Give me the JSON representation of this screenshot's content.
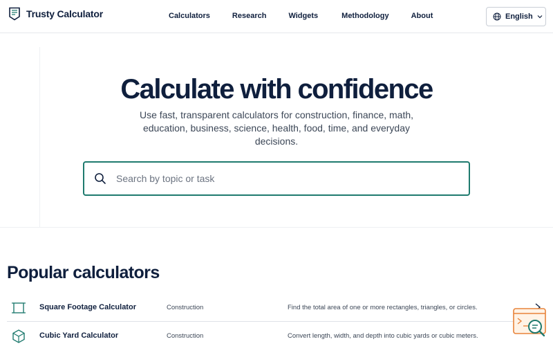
{
  "header": {
    "brand_name": "Trusty Calculator",
    "nav": [
      {
        "label": "Calculators"
      },
      {
        "label": "Research"
      },
      {
        "label": "Widgets"
      },
      {
        "label": "Methodology"
      },
      {
        "label": "About"
      }
    ],
    "language": {
      "label": "English",
      "icon": "globe-icon"
    }
  },
  "hero": {
    "title": "Calculate with confidence",
    "subtitle": "Use fast, transparent calculators for construction, finance, math, education, business, science, health, food, time, and everyday decisions.",
    "search": {
      "placeholder": "Search by topic or task",
      "value": ""
    }
  },
  "popular": {
    "title": "Popular calculators",
    "items": [
      {
        "name": "Square Footage Calculator",
        "category": "Construction",
        "description": "Find the total area of one or more rectangles, triangles, or circles.",
        "icon": "square-icon"
      },
      {
        "name": "Cubic Yard Calculator",
        "category": "Construction",
        "description": "Convert length, width, and depth into cubic yards or cubic meters.",
        "icon": "cube-icon"
      }
    ]
  },
  "colors": {
    "accent": "#1e7a6e",
    "text_primary": "#0f1f3d",
    "widget_orange": "#e8833a"
  }
}
